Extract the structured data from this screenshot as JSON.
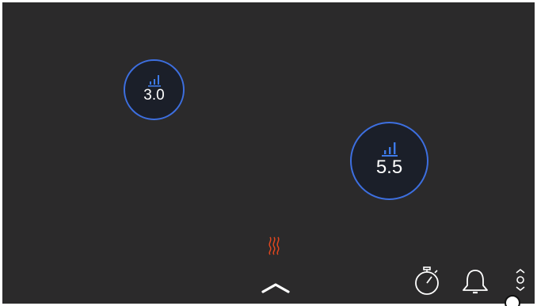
{
  "colors": {
    "background": "#2b2a2b",
    "zone_fill": "#1b1f29",
    "zone_ring": "#3d6fe0",
    "power_icon": "#3d7ae8",
    "heat_icon": "#e0471f",
    "text": "#ffffff"
  },
  "zones": [
    {
      "value": "3.0",
      "icon": "power-level-icon"
    },
    {
      "value": "5.5",
      "icon": "power-level-icon"
    }
  ],
  "bottom_bar": {
    "icons": [
      "residual-heat-icon",
      "chevron-up-icon",
      "timer-icon",
      "bell-icon",
      "up-down-icon"
    ]
  }
}
